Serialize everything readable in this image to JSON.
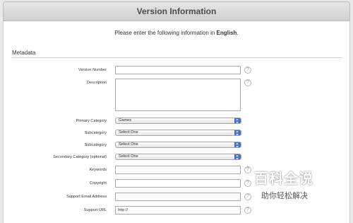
{
  "header": {
    "title": "Version Information"
  },
  "intro": {
    "text_before": "Please enter the following information in ",
    "language": "English",
    "text_after": "."
  },
  "section": {
    "title": "Metadata"
  },
  "fields": {
    "version_number": {
      "label": "Version Number",
      "value": ""
    },
    "description": {
      "label": "Description",
      "value": ""
    },
    "primary_category": {
      "label": "Primary Category",
      "value": "Games"
    },
    "subcategory_1": {
      "label": "Subcategory",
      "value": "Select One"
    },
    "subcategory_2": {
      "label": "Subcategory",
      "value": "Select One"
    },
    "secondary_category": {
      "label": "Secondary Category (optional)",
      "value": "Select One"
    },
    "keywords": {
      "label": "Keywords",
      "value": ""
    },
    "copyright": {
      "label": "Copyright",
      "value": ""
    },
    "support_email": {
      "label": "Support Email Address",
      "value": ""
    },
    "support_url": {
      "label": "Support URL",
      "value": "http://"
    }
  },
  "help_glyph": "?",
  "watermark": {
    "title": "百科全说",
    "subtitle": "助你轻松解决"
  },
  "colors": {
    "select_arrow": "#3f6fd6",
    "panel_bg": "#ffffff",
    "header_text": "#4b4b4b"
  },
  "icons": {
    "help": "question-circle-icon",
    "dropdown": "updown-arrows-icon"
  }
}
